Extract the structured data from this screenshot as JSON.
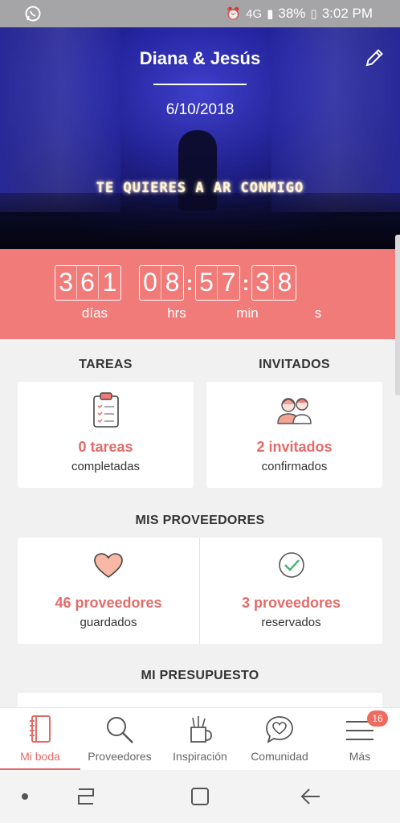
{
  "status_bar": {
    "left_icon": "whatsapp-icon",
    "signal": "4G",
    "battery": "38%",
    "time": "3:02 PM"
  },
  "hero": {
    "title": "Diana & Jesús",
    "date": "6/10/2018",
    "sign_text": "TE QUIERES  A AR CONMIGO",
    "edit_icon": "pencil-icon"
  },
  "countdown": {
    "days": [
      "3",
      "6",
      "1"
    ],
    "hours": [
      "0",
      "8"
    ],
    "minutes": [
      "5",
      "7"
    ],
    "seconds": [
      "3",
      "8"
    ],
    "labels": {
      "days": "días",
      "hours": "hrs",
      "minutes": "min",
      "seconds": "s"
    },
    "accent": "#f07b78"
  },
  "tasks": {
    "heading": "TAREAS",
    "count": "0 tareas",
    "label": "completadas",
    "icon": "clipboard-icon"
  },
  "guests": {
    "heading": "INVITADOS",
    "count": "2 invitados",
    "label": "confirmados",
    "icon": "guests-icon"
  },
  "vendors": {
    "heading": "MIS PROVEEDORES",
    "saved_count": "46 proveedores",
    "saved_label": "guardados",
    "booked_count": "3 proveedores",
    "booked_label": "reservados"
  },
  "budget": {
    "heading": "MI PRESUPUESTO"
  },
  "tabs": [
    {
      "label": "Mi boda",
      "icon": "wedding-notebook-icon",
      "active": true
    },
    {
      "label": "Proveedores",
      "icon": "search-icon"
    },
    {
      "label": "Inspiración",
      "icon": "inspiration-icon"
    },
    {
      "label": "Comunidad",
      "icon": "community-heart-icon"
    },
    {
      "label": "Más",
      "icon": "menu-icon",
      "badge": "16"
    }
  ],
  "colors": {
    "brand": "#e46b68",
    "countdown_bg": "#f07b78",
    "page_bg": "#f1f1f2"
  }
}
